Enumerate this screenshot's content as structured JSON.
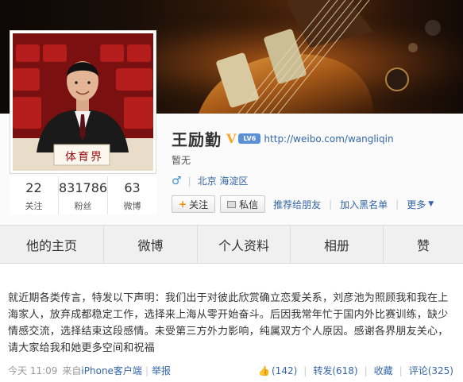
{
  "profile": {
    "name": "王励勤",
    "verified_badge": "V",
    "level_badge": "LV6",
    "url": "http://weibo.com/wangliqin",
    "description": "暂无",
    "gender_symbol": "♂",
    "location": "北京 海淀区",
    "placard_text": "体育界"
  },
  "stats": [
    {
      "value": "22",
      "label": "关注"
    },
    {
      "value": "831786",
      "label": "粉丝"
    },
    {
      "value": "63",
      "label": "微博"
    }
  ],
  "actions": {
    "follow_plus": "+",
    "follow_label": "关注",
    "message_label": "私信",
    "recommend_label": "推荐给朋友",
    "blacklist_label": "加入黑名单",
    "more_label": "更多"
  },
  "tabs": [
    "他的主页",
    "微博",
    "个人资料",
    "相册",
    "赞"
  ],
  "post": {
    "text": "就近期各类传言，特发以下声明：我们出于对彼此欣赏确立恋爱关系，刘彦池为照顾我和我在上海家人，放弃成都稳定工作，选择来上海从零开始奋斗。后因我常年忙于国内外比赛训练，缺少情感交流，选择结束这段感情。未受第三方外力影响，纯属双方个人原因。感谢各界朋友关心，请大家给我和她更多空间和祝福",
    "time": "今天 11:09",
    "from_prefix": "来自",
    "from_client": "iPhone客户端",
    "report": "举报",
    "likes": "(142)",
    "repost": "转发(618)",
    "favorite": "收藏",
    "comment": "评论(325)"
  },
  "colors": {
    "link": "#3366aa",
    "verified": "#f5a623",
    "follow_plus": "#f08c00"
  }
}
